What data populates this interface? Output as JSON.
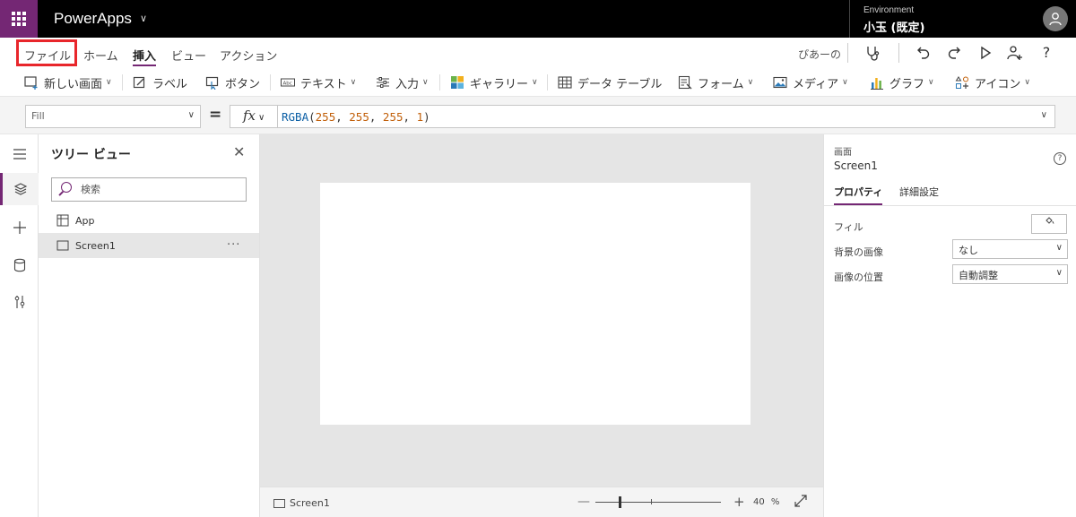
{
  "topbar": {
    "app_name": "PowerApps",
    "environment_label": "Environment",
    "environment_name": "小玉 (既定)"
  },
  "menu": {
    "items": [
      "ファイル",
      "ホーム",
      "挿入",
      "ビュー",
      "アクション"
    ],
    "active": "挿入",
    "highlighted": "ファイル",
    "user_label": "ぴあーの"
  },
  "ribbon": {
    "new_screen": "新しい画面",
    "label": "ラベル",
    "button": "ボタン",
    "text": "テキスト",
    "input": "入力",
    "gallery": "ギャラリー",
    "data_table": "データ テーブル",
    "form": "フォーム",
    "media": "メディア",
    "chart": "グラフ",
    "icons": "アイコン"
  },
  "formula": {
    "property": "Fill",
    "fx": "fx",
    "fn_name": "RGBA",
    "open": "(",
    "r": "255",
    "g": "255",
    "b": "255",
    "a": "1",
    "close": ")",
    "sep": ", "
  },
  "tree": {
    "title": "ツリー ビュー",
    "search_placeholder": "検索",
    "items": [
      "App",
      "Screen1"
    ],
    "more": "···"
  },
  "status": {
    "screen_name": "Screen1",
    "zoom_value": "40",
    "zoom_unit": "%",
    "zoom_level": 0.4
  },
  "properties": {
    "type": "画面",
    "name": "Screen1",
    "help": "?",
    "tabs": [
      "プロパティ",
      "詳細設定"
    ],
    "fill_label": "フィル",
    "background_image_label": "背景の画像",
    "background_image_value": "なし",
    "image_position_label": "画像の位置",
    "image_position_value": "自動調整"
  },
  "colors": {
    "brand": "#742774",
    "highlight": "#e8262b",
    "fn": "#0b5fa5",
    "number": "#c15f09"
  }
}
